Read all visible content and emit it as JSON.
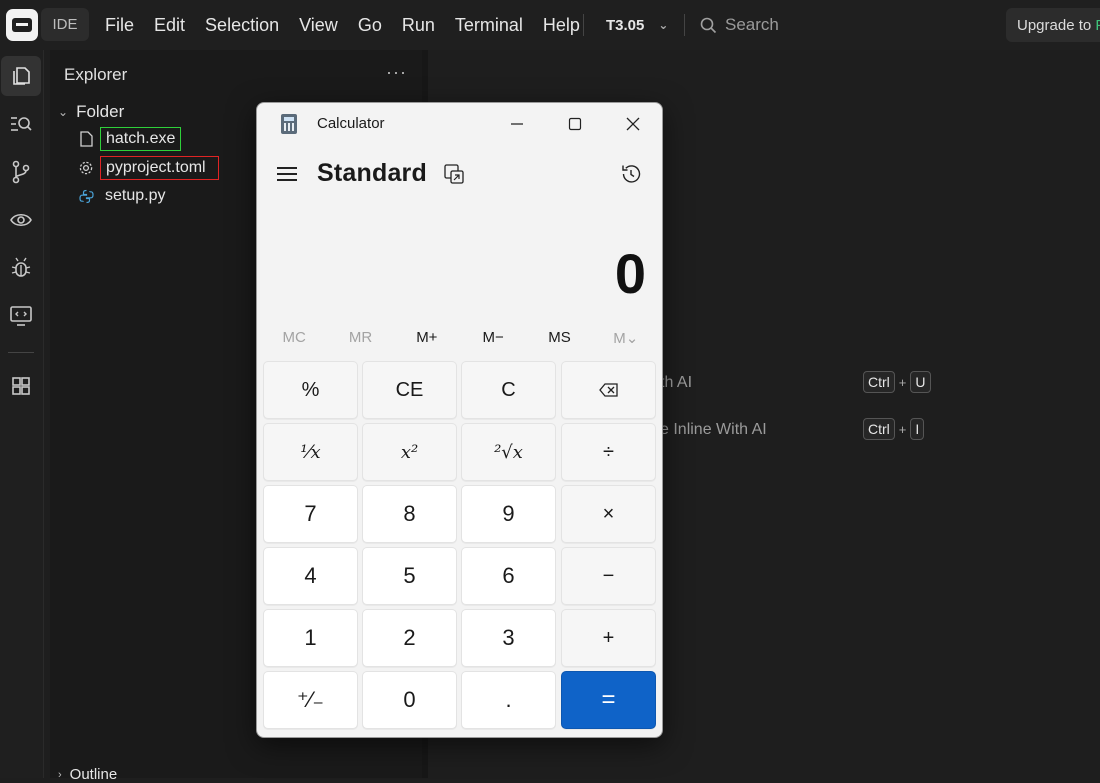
{
  "titlebar": {
    "ide_label": "IDE",
    "menu": [
      "File",
      "Edit",
      "Selection",
      "View",
      "Go",
      "Run",
      "Terminal",
      "Help"
    ],
    "version": "T3.05",
    "search_placeholder": "Search",
    "upgrade_label": "Upgrade to",
    "upgrade_suffix": "P"
  },
  "sidebar": {
    "title": "Explorer",
    "more": "···",
    "folder": "Folder",
    "files": [
      {
        "name": "hatch.exe",
        "icon": "file-icon",
        "highlight": "green"
      },
      {
        "name": "pyproject.toml",
        "icon": "settings-gear-icon",
        "highlight": "red"
      },
      {
        "name": "setup.py",
        "icon": "python-icon",
        "highlight": null
      }
    ],
    "outline": "Outline"
  },
  "editor": {
    "hints": [
      {
        "text": "th AI",
        "keys": [
          "Ctrl",
          "U"
        ]
      },
      {
        "text": "e Inline With AI",
        "keys": [
          "Ctrl",
          "I"
        ]
      }
    ]
  },
  "calculator": {
    "title": "Calculator",
    "mode": "Standard",
    "display": "0",
    "memory": [
      "MC",
      "MR",
      "M+",
      "M−",
      "MS",
      "M⌄"
    ],
    "memory_enabled": [
      false,
      false,
      true,
      true,
      true,
      false
    ],
    "keys": [
      [
        "%",
        "CE",
        "C",
        "⌫"
      ],
      [
        "¹⁄x",
        "x²",
        "²√x",
        "÷"
      ],
      [
        "7",
        "8",
        "9",
        "×"
      ],
      [
        "4",
        "5",
        "6",
        "−"
      ],
      [
        "1",
        "2",
        "3",
        "+"
      ],
      [
        "⁺⁄₋",
        "0",
        ".",
        "="
      ]
    ],
    "accent_color": "#0f63c8"
  }
}
